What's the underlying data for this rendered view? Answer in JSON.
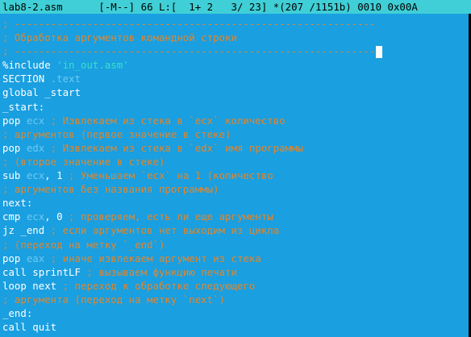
{
  "status_bar": {
    "filename": "lab8-2.asm",
    "mode": "[-M--]",
    "col": "66",
    "pos": "L:[  1+ 2   3/ 23]",
    "offset": "*(207 /1151b)",
    "charcode": "0010 0x00A"
  },
  "editor": {
    "lines": [
      {
        "c": "; ------------------------------------------------------------"
      },
      {
        "c": "; Обработка аргументов командной строки"
      },
      {
        "c": "; ------------------------------------------------------------"
      },
      {
        "t": "%include ",
        "s": "'in_out.asm'"
      },
      {
        "t": "SECTION ",
        "k": ".text"
      },
      {
        "t": "global _start"
      },
      {
        "t": "_start:"
      },
      {
        "t": "pop ",
        "k": "ecx",
        "c": " ; Извлекаем из стека в `ecx` количество"
      },
      {
        "c": "; аргументов (первое значение в стеке)"
      },
      {
        "t": "pop ",
        "k": "edx",
        "c": " ; Извлекаем из стека в `edx` имя программы"
      },
      {
        "c": "; (второе значение в стеке)"
      },
      {
        "t": "sub ",
        "k": "ecx",
        "t2": ", 1",
        "c": " ; Уменьшаем `ecx` на 1 (количество"
      },
      {
        "c": "; аргументов без названия программы)"
      },
      {
        "t": "next:"
      },
      {
        "t": "cmp ",
        "k": "ecx",
        "t2": ", 0",
        "c": " ; проверяем, есть ли еще аргументы"
      },
      {
        "t": "jz _end",
        "c": " ; если аргументов нет выходим из цикла"
      },
      {
        "c": "; (переход на метку `_end`)"
      },
      {
        "t": "pop ",
        "k": "eax",
        "c": " ; иначе извлекаем аргумент из стека"
      },
      {
        "t": "call sprintLF",
        "c": " ; вызываем функцию печати"
      },
      {
        "t": "loop next",
        "c": " ; переход к обработке следующего"
      },
      {
        "c": "; аргумента (переход на метку `next`)"
      },
      {
        "t": "_end:"
      },
      {
        "t": "call quit"
      }
    ]
  }
}
